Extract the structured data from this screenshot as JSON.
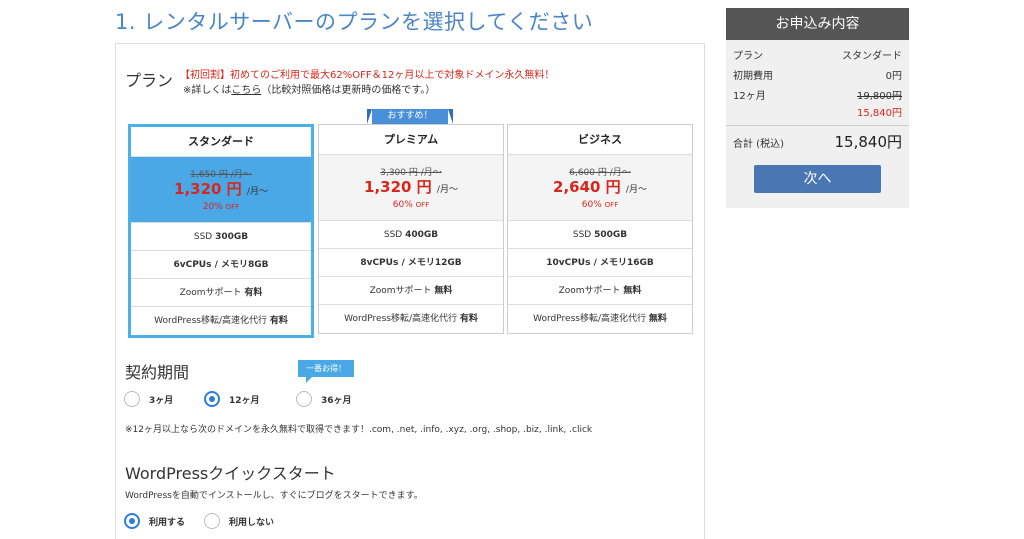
{
  "page_title": "1. レンタルサーバーのプランを選択してください",
  "plan_section": {
    "label": "プラン",
    "promo": "【初回割】初めてのご利用で最大62%OFF＆12ヶ月以上で対象ドメイン永久無料！",
    "note_prefix": "※詳しくは",
    "note_link": "こちら",
    "note_suffix": "（比較対照価格は更新時の価格です。）",
    "ribbon": "おすすめ！"
  },
  "plans": [
    {
      "name": "スタンダード",
      "original_price": "1,650 円 /月〜",
      "price": "1,320 円",
      "price_unit": "/月〜",
      "discount": "20%",
      "off": "OFF",
      "selected": true,
      "ssd_label": "SSD ",
      "ssd_value": "300GB",
      "cpu": "6vCPUs / メモリ8GB",
      "zoom_label": "Zoomサポート ",
      "zoom_value": "有料",
      "wp_label": "WordPress移転/高速化代行 ",
      "wp_value": "有料"
    },
    {
      "name": "プレミアム",
      "original_price": "3,300 円 /月〜",
      "price": "1,320 円",
      "price_unit": "/月〜",
      "discount": "60%",
      "off": "OFF",
      "selected": false,
      "ssd_label": "SSD ",
      "ssd_value": "400GB",
      "cpu": "8vCPUs / メモリ12GB",
      "zoom_label": "Zoomサポート ",
      "zoom_value": "無料",
      "wp_label": "WordPress移転/高速化代行 ",
      "wp_value": "有料"
    },
    {
      "name": "ビジネス",
      "original_price": "6,600 円 /月〜",
      "price": "2,640 円",
      "price_unit": "/月〜",
      "discount": "60%",
      "off": "OFF",
      "selected": false,
      "ssd_label": "SSD ",
      "ssd_value": "500GB",
      "cpu": "10vCPUs / メモリ16GB",
      "zoom_label": "Zoomサポート ",
      "zoom_value": "無料",
      "wp_label": "WordPress移転/高速化代行 ",
      "wp_value": "無料"
    }
  ],
  "contract": {
    "title": "契約期間",
    "badge": "一番お得！",
    "options": [
      {
        "label": "3ヶ月",
        "selected": false
      },
      {
        "label": "12ヶ月",
        "selected": true
      },
      {
        "label": "36ヶ月",
        "selected": false
      }
    ],
    "note": "※12ヶ月以上なら次のドメインを永久無料で取得できます！.com, .net, .info, .xyz, .org, .shop, .biz, .link, .click"
  },
  "wordpress": {
    "title": "WordPressクイックスタート",
    "description": "WordPressを自動でインストールし、すぐにブログをスタートできます。",
    "options": [
      {
        "label": "利用する",
        "selected": true
      },
      {
        "label": "利用しない",
        "selected": false
      }
    ]
  },
  "sidebar": {
    "title": "お申込み内容",
    "plan_label": "プラン",
    "plan_value": "スタンダード",
    "initial_fee_label": "初期費用",
    "initial_fee_value": "0円",
    "term_label": "12ヶ月",
    "term_original": "19,800円",
    "term_price": "15,840円",
    "total_label": "合計 (税込)",
    "total_value": "15,840円",
    "next_button": "次へ"
  },
  "colors": {
    "title_blue": "#4a86c5",
    "selected_plan_bg": "#4aa8e6",
    "price_red": "#d9261c",
    "button_blue": "#4a77b4",
    "radio_blue": "#2b7de0"
  }
}
